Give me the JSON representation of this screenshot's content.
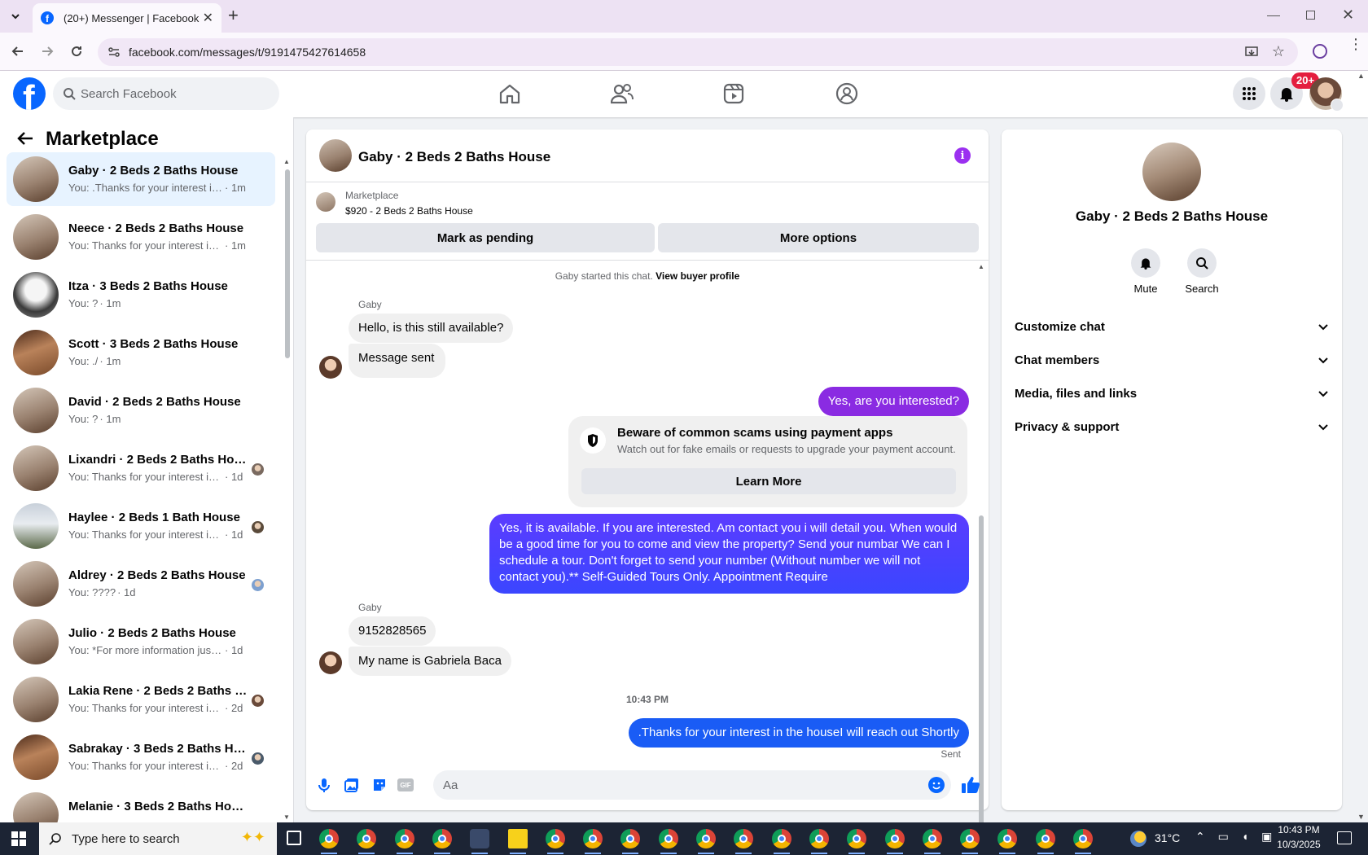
{
  "browser": {
    "tab_title": "(20+) Messenger | Facebook",
    "url": "facebook.com/messages/t/9191475427614658"
  },
  "topbar": {
    "search_placeholder": "Search Facebook",
    "notification_count": "20+"
  },
  "sidebar": {
    "title": "Marketplace",
    "items": [
      {
        "name": "Gaby · 2 Beds 2 Baths House",
        "preview": "You: .Thanks for your interest in th...",
        "time": "· 1m",
        "active": true
      },
      {
        "name": "Neece · 2 Beds 2 Baths House",
        "preview": "You: Thanks for your interest in the...",
        "time": "· 1m"
      },
      {
        "name": "Itza · 3 Beds 2 Baths House",
        "preview": "You: ?",
        "time": "· 1m"
      },
      {
        "name": "Scott · 3 Beds 2 Baths House",
        "preview": "You: ./",
        "time": "· 1m"
      },
      {
        "name": "David · 2 Beds 2 Baths House",
        "preview": "You: ?",
        "time": "· 1m"
      },
      {
        "name": "Lixandri · 2 Beds 2 Baths House",
        "preview": "You: Thanks for your interest in t...",
        "time": "· 1d"
      },
      {
        "name": "Haylee · 2 Beds 1 Bath House",
        "preview": "You: Thanks for your interest in t...",
        "time": "· 1d"
      },
      {
        "name": "Aldrey · 2 Beds 2 Baths House",
        "preview": "You: ????",
        "time": "· 1d"
      },
      {
        "name": "Julio · 2 Beds 2 Baths House",
        "preview": "You: *For more information just sen...",
        "time": "· 1d"
      },
      {
        "name": "Lakia Rene · 2 Beds 2 Baths H...",
        "preview": "You: Thanks for your interest in t...",
        "time": "· 2d"
      },
      {
        "name": "Sabrakay · 3 Beds 2 Baths Ho...",
        "preview": "You: Thanks for your interest in t...",
        "time": "· 2d"
      },
      {
        "name": "Melanie · 3 Beds 2 Baths House",
        "preview": "",
        "time": ""
      }
    ]
  },
  "chat": {
    "title": "Gaby · 2 Beds 2 Baths House",
    "listing_label": "Marketplace",
    "listing_price": "$920 - 2 Beds 2 Baths House",
    "mark_pending": "Mark as pending",
    "more_options": "More options",
    "started_text": "Gaby started this chat.",
    "view_profile": "View buyer profile",
    "sender_name": "Gaby",
    "msg1": "Hello, is this still available?",
    "msg2": "Message sent",
    "msg3": "Yes, are you interested?",
    "warn_title": "Beware of common scams using payment apps",
    "warn_body": "Watch out for fake emails or requests to upgrade your payment account.",
    "learn_more": "Learn More",
    "msg4": "Yes, it is available. If you are interested.  Am contact you i will detail you.  When would be a good time for you to come and view the property? Send your numbar We can I schedule a tour.  Don't forget to send your number (Without number we will not contact you).** Self-Guided Tours Only. Appointment Require",
    "sender_name2": "Gaby",
    "msg5": "9152828565",
    "msg6": "My name is Gabriela Baca",
    "timestamp": "10:43 PM",
    "msg7": ".Thanks for your interest in the houseI will reach out Shortly",
    "sent_status": "Sent",
    "composer_placeholder": "Aa"
  },
  "details": {
    "name": "Gaby · 2 Beds 2 Baths House",
    "mute": "Mute",
    "search": "Search",
    "sections": [
      "Customize chat",
      "Chat members",
      "Media, files and links",
      "Privacy & support"
    ]
  },
  "taskbar": {
    "search_placeholder": "Type here to search",
    "temperature": "31°C",
    "time": "10:43 PM",
    "date": "10/3/2025"
  },
  "colors": {
    "fb_blue": "#0866ff",
    "bubble_purple": "#8a2be2",
    "bubble_indigo": "#4b3bff",
    "bubble_blue": "#1a5cf5"
  }
}
